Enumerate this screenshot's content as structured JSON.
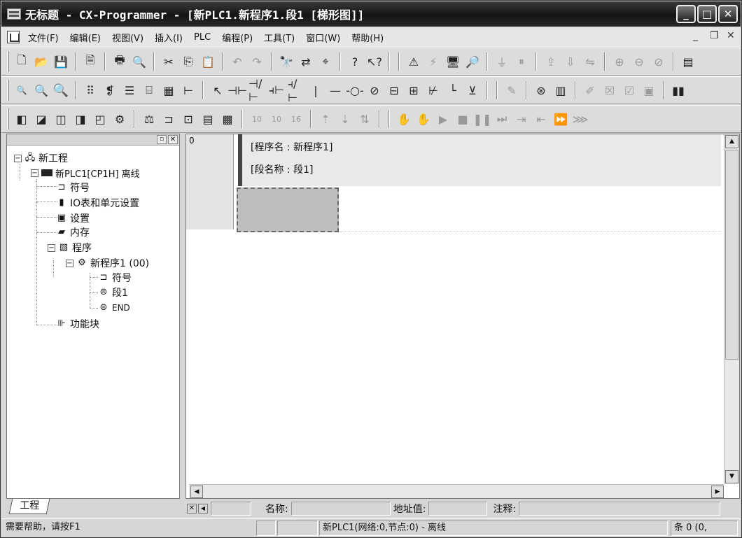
{
  "window": {
    "title": "无标题 - CX-Programmer - [新PLC1.新程序1.段1 [梯形图]]"
  },
  "window_controls": {
    "minimize": "_",
    "maximize": "□",
    "close": "✕"
  },
  "menu": {
    "items": [
      "文件(F)",
      "编辑(E)",
      "视图(V)",
      "插入(I)",
      "PLC",
      "编程(P)",
      "工具(T)",
      "窗口(W)",
      "帮助(H)"
    ],
    "mdi_min": "_",
    "mdi_restore": "❐",
    "mdi_close": "✕"
  },
  "tree": {
    "project": "新工程",
    "plc": "新PLC1[CP1H] 离线",
    "symbols": "符号",
    "io_table": "IO表和单元设置",
    "settings": "设置",
    "memory": "内存",
    "programs": "程序",
    "program1": "新程序1 (00)",
    "prog_symbols": "符号",
    "section1": "段1",
    "end": "END",
    "function_blocks": "功能块"
  },
  "project_tab": "工程",
  "ladder": {
    "rung_number": "0",
    "program_name": "[程序名 : 新程序1]",
    "section_name": "[段名称 : 段1]"
  },
  "infobar": {
    "name_label": "名称:",
    "address_label": "地址值:",
    "comment_label": "注释:"
  },
  "status": {
    "help": "需要帮助，请按F1",
    "connection": "新PLC1(网络:0,节点:0) - 离线",
    "position": "条 0 (0,"
  }
}
